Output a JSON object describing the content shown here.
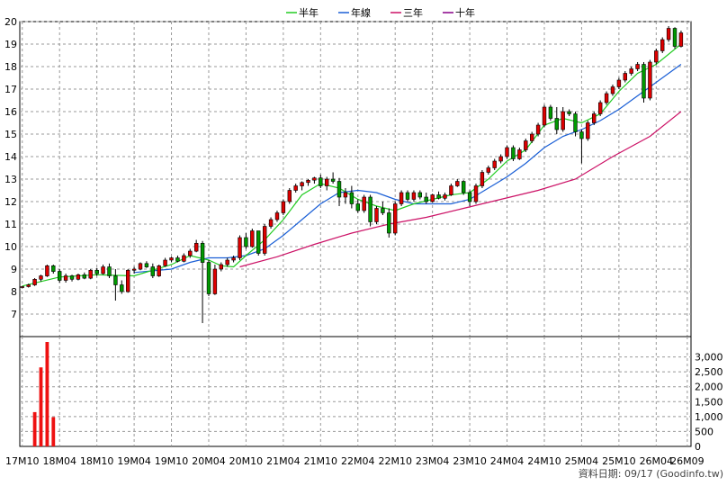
{
  "chart_data": [
    {
      "type": "candlestick",
      "title": "",
      "legend_position": "top-center",
      "grid": true,
      "legend": [
        {
          "label": "半年",
          "color": "#22cc22"
        },
        {
          "label": "年線",
          "color": "#1a5fd6"
        },
        {
          "label": "三年",
          "color": "#cc1166"
        },
        {
          "label": "十年",
          "color": "#880088"
        }
      ],
      "ylim": [
        6,
        20
      ],
      "y_ticks": [
        "7",
        "8",
        "9",
        "10",
        "11",
        "12",
        "13",
        "14",
        "15",
        "16",
        "17",
        "18",
        "19",
        "20"
      ],
      "x_ticks": [
        "17M10",
        "18M04",
        "18M10",
        "19M04",
        "19M10",
        "20M04",
        "20M10",
        "21M04",
        "21M10",
        "22M04",
        "22M10",
        "23M04",
        "23M10",
        "24M04",
        "24M10",
        "25M04",
        "25M10",
        "26M04",
        "26M09"
      ],
      "x_range": [
        "2017-10",
        "2026-09"
      ],
      "candles": [
        [
          "2017-10",
          8.2,
          8.25,
          8.15,
          8.22
        ],
        [
          "2017-11",
          8.22,
          8.35,
          8.18,
          8.3
        ],
        [
          "2017-12",
          8.3,
          8.6,
          8.25,
          8.55
        ],
        [
          "2018-01",
          8.55,
          8.75,
          8.45,
          8.7
        ],
        [
          "2018-02",
          8.7,
          9.2,
          8.65,
          9.15
        ],
        [
          "2018-03",
          9.15,
          9.2,
          8.8,
          8.9
        ],
        [
          "2018-04",
          8.9,
          9.0,
          8.4,
          8.5
        ],
        [
          "2018-05",
          8.5,
          8.8,
          8.4,
          8.7
        ],
        [
          "2018-06",
          8.7,
          8.75,
          8.45,
          8.55
        ],
        [
          "2018-07",
          8.55,
          8.8,
          8.5,
          8.75
        ],
        [
          "2018-08",
          8.75,
          8.85,
          8.55,
          8.6
        ],
        [
          "2018-09",
          8.6,
          9.0,
          8.55,
          8.95
        ],
        [
          "2018-10",
          8.95,
          9.05,
          8.7,
          8.8
        ],
        [
          "2018-11",
          8.8,
          9.2,
          8.75,
          9.1
        ],
        [
          "2018-12",
          9.1,
          9.25,
          8.6,
          8.7
        ],
        [
          "2019-01",
          8.7,
          9.0,
          7.6,
          8.3
        ],
        [
          "2019-02",
          8.3,
          8.5,
          7.9,
          8.0
        ],
        [
          "2019-03",
          8.0,
          9.0,
          7.95,
          8.95
        ],
        [
          "2019-04",
          8.95,
          9.1,
          8.8,
          9.0
        ],
        [
          "2019-05",
          9.0,
          9.3,
          8.95,
          9.25
        ],
        [
          "2019-06",
          9.25,
          9.35,
          9.05,
          9.1
        ],
        [
          "2019-07",
          9.1,
          9.25,
          8.6,
          8.7
        ],
        [
          "2019-08",
          8.7,
          9.2,
          8.65,
          9.15
        ],
        [
          "2019-09",
          9.15,
          9.5,
          9.1,
          9.4
        ],
        [
          "2019-10",
          9.4,
          9.55,
          9.3,
          9.5
        ],
        [
          "2019-11",
          9.5,
          9.6,
          9.3,
          9.35
        ],
        [
          "2019-12",
          9.35,
          9.7,
          9.3,
          9.6
        ],
        [
          "2020-01",
          9.6,
          9.9,
          9.5,
          9.8
        ],
        [
          "2020-02",
          9.8,
          10.3,
          9.75,
          10.15
        ],
        [
          "2020-03",
          10.15,
          10.25,
          6.6,
          9.3
        ],
        [
          "2020-04",
          9.3,
          9.4,
          7.8,
          7.9
        ],
        [
          "2020-05",
          7.9,
          9.2,
          7.85,
          9.0
        ],
        [
          "2020-06",
          9.0,
          9.3,
          8.9,
          9.2
        ],
        [
          "2020-07",
          9.2,
          9.5,
          9.1,
          9.4
        ],
        [
          "2020-08",
          9.4,
          9.6,
          9.3,
          9.5
        ],
        [
          "2020-09",
          9.5,
          10.5,
          9.4,
          10.4
        ],
        [
          "2020-10",
          10.4,
          10.6,
          9.9,
          10.0
        ],
        [
          "2020-11",
          10.0,
          10.8,
          9.95,
          10.7
        ],
        [
          "2020-12",
          10.7,
          10.6,
          9.6,
          9.7
        ],
        [
          "2021-01",
          9.7,
          11.0,
          9.6,
          10.9
        ],
        [
          "2021-02",
          10.9,
          11.3,
          10.8,
          11.2
        ],
        [
          "2021-03",
          11.2,
          11.6,
          11.1,
          11.5
        ],
        [
          "2021-04",
          11.5,
          12.1,
          11.4,
          12.0
        ],
        [
          "2021-05",
          12.0,
          12.6,
          11.9,
          12.5
        ],
        [
          "2021-06",
          12.5,
          12.8,
          12.4,
          12.7
        ],
        [
          "2021-07",
          12.7,
          12.9,
          12.5,
          12.85
        ],
        [
          "2021-08",
          12.85,
          13.0,
          12.7,
          12.95
        ],
        [
          "2021-09",
          12.95,
          13.1,
          12.8,
          13.05
        ],
        [
          "2021-10",
          13.05,
          13.2,
          12.6,
          12.7
        ],
        [
          "2021-11",
          12.7,
          13.1,
          12.5,
          13.0
        ],
        [
          "2021-12",
          13.0,
          13.3,
          12.8,
          12.9
        ],
        [
          "2022-01",
          12.9,
          13.05,
          11.8,
          12.2
        ],
        [
          "2022-02",
          12.2,
          12.6,
          11.9,
          12.4
        ],
        [
          "2022-03",
          12.4,
          12.7,
          11.7,
          11.9
        ],
        [
          "2022-04",
          11.9,
          12.1,
          11.5,
          11.6
        ],
        [
          "2022-05",
          11.6,
          12.3,
          11.5,
          12.2
        ],
        [
          "2022-06",
          12.2,
          12.3,
          10.9,
          11.1
        ],
        [
          "2022-07",
          11.1,
          11.8,
          11.0,
          11.7
        ],
        [
          "2022-08",
          11.7,
          12.0,
          11.4,
          11.5
        ],
        [
          "2022-09",
          11.5,
          11.7,
          10.4,
          10.6
        ],
        [
          "2022-10",
          10.6,
          12.0,
          10.5,
          11.9
        ],
        [
          "2022-11",
          11.9,
          12.5,
          11.8,
          12.4
        ],
        [
          "2022-12",
          12.4,
          12.5,
          12.0,
          12.1
        ],
        [
          "2023-01",
          12.1,
          12.5,
          12.0,
          12.4
        ],
        [
          "2023-02",
          12.4,
          12.5,
          12.1,
          12.2
        ],
        [
          "2023-03",
          12.2,
          12.4,
          11.9,
          12.0
        ],
        [
          "2023-04",
          12.0,
          12.35,
          11.95,
          12.3
        ],
        [
          "2023-05",
          12.3,
          12.45,
          12.1,
          12.15
        ],
        [
          "2023-06",
          12.15,
          12.4,
          12.05,
          12.3
        ],
        [
          "2023-07",
          12.3,
          12.8,
          12.25,
          12.7
        ],
        [
          "2023-08",
          12.7,
          13.0,
          12.65,
          12.9
        ],
        [
          "2023-09",
          12.9,
          12.95,
          12.3,
          12.4
        ],
        [
          "2023-10",
          12.4,
          12.5,
          11.8,
          12.0
        ],
        [
          "2023-11",
          12.0,
          12.8,
          11.9,
          12.7
        ],
        [
          "2023-12",
          12.7,
          13.4,
          12.6,
          13.3
        ],
        [
          "2024-01",
          13.3,
          13.6,
          13.2,
          13.5
        ],
        [
          "2024-02",
          13.5,
          13.9,
          13.4,
          13.8
        ],
        [
          "2024-03",
          13.8,
          14.1,
          13.7,
          14.0
        ],
        [
          "2024-04",
          14.0,
          14.5,
          13.9,
          14.4
        ],
        [
          "2024-05",
          14.4,
          14.5,
          13.8,
          13.9
        ],
        [
          "2024-06",
          13.9,
          14.4,
          13.85,
          14.3
        ],
        [
          "2024-07",
          14.3,
          14.8,
          14.2,
          14.7
        ],
        [
          "2024-08",
          14.7,
          15.1,
          14.6,
          15.0
        ],
        [
          "2024-09",
          15.0,
          15.5,
          14.9,
          15.4
        ],
        [
          "2024-10",
          15.4,
          16.3,
          15.3,
          16.2
        ],
        [
          "2024-11",
          16.2,
          16.3,
          15.6,
          15.7
        ],
        [
          "2024-12",
          15.7,
          16.2,
          15.0,
          15.2
        ],
        [
          "2025-01",
          15.2,
          16.2,
          15.1,
          16.0
        ],
        [
          "2025-02",
          16.0,
          16.1,
          15.8,
          15.9
        ],
        [
          "2025-03",
          15.9,
          16.0,
          14.9,
          15.1
        ],
        [
          "2025-04",
          15.1,
          15.2,
          13.7,
          14.8
        ],
        [
          "2025-05",
          14.8,
          15.6,
          14.7,
          15.5
        ],
        [
          "2025-06",
          15.5,
          16.0,
          15.4,
          15.9
        ],
        [
          "2025-07",
          15.9,
          16.5,
          15.8,
          16.4
        ],
        [
          "2025-08",
          16.4,
          16.9,
          16.3,
          16.8
        ],
        [
          "2025-09",
          16.8,
          17.2,
          16.7,
          17.1
        ],
        [
          "2025-10",
          17.1,
          17.5,
          17.0,
          17.4
        ],
        [
          "2025-11",
          17.4,
          17.8,
          17.3,
          17.7
        ],
        [
          "2025-12",
          17.7,
          18.0,
          17.6,
          17.9
        ],
        [
          "2026-01",
          17.9,
          18.2,
          17.8,
          18.1
        ],
        [
          "2026-02",
          18.1,
          18.2,
          16.4,
          16.6
        ],
        [
          "2026-03",
          16.6,
          18.3,
          16.5,
          18.2
        ],
        [
          "2026-04",
          18.2,
          18.8,
          18.1,
          18.7
        ],
        [
          "2026-05",
          18.7,
          19.3,
          18.6,
          19.2
        ],
        [
          "2026-06",
          19.2,
          19.8,
          19.1,
          19.7
        ],
        [
          "2026-07",
          19.7,
          19.75,
          18.8,
          18.9
        ],
        [
          "2026-08",
          18.9,
          19.6,
          18.85,
          19.5
        ]
      ],
      "ma_halfyear": [
        [
          "2017-10",
          8.25
        ],
        [
          "2018-04",
          8.65
        ],
        [
          "2018-10",
          8.75
        ],
        [
          "2019-04",
          8.7
        ],
        [
          "2019-10",
          9.2
        ],
        [
          "2020-01",
          9.6
        ],
        [
          "2020-04",
          9.4
        ],
        [
          "2020-06",
          9.15
        ],
        [
          "2020-08",
          9.1
        ],
        [
          "2020-10",
          9.6
        ],
        [
          "2021-01",
          10.3
        ],
        [
          "2021-04",
          11.2
        ],
        [
          "2021-07",
          12.3
        ],
        [
          "2021-10",
          12.8
        ],
        [
          "2022-01",
          12.6
        ],
        [
          "2022-04",
          12.1
        ],
        [
          "2022-07",
          11.8
        ],
        [
          "2022-10",
          11.6
        ],
        [
          "2023-01",
          11.9
        ],
        [
          "2023-04",
          12.1
        ],
        [
          "2023-07",
          12.3
        ],
        [
          "2023-10",
          12.4
        ],
        [
          "2024-01",
          13.0
        ],
        [
          "2024-04",
          13.8
        ],
        [
          "2024-07",
          14.3
        ],
        [
          "2024-10",
          15.4
        ],
        [
          "2025-01",
          15.7
        ],
        [
          "2025-04",
          15.5
        ],
        [
          "2025-07",
          15.9
        ],
        [
          "2025-10",
          16.9
        ],
        [
          "2026-01",
          17.7
        ],
        [
          "2026-04",
          18.1
        ],
        [
          "2026-08",
          19.0
        ]
      ],
      "ma_year": [
        [
          "2019-04",
          8.85
        ],
        [
          "2019-10",
          9.0
        ],
        [
          "2020-01",
          9.3
        ],
        [
          "2020-04",
          9.5
        ],
        [
          "2020-07",
          9.5
        ],
        [
          "2020-10",
          9.6
        ],
        [
          "2021-01",
          9.9
        ],
        [
          "2021-04",
          10.5
        ],
        [
          "2021-07",
          11.2
        ],
        [
          "2021-10",
          11.9
        ],
        [
          "2022-01",
          12.4
        ],
        [
          "2022-04",
          12.5
        ],
        [
          "2022-07",
          12.4
        ],
        [
          "2022-10",
          12.1
        ],
        [
          "2023-01",
          11.9
        ],
        [
          "2023-04",
          11.9
        ],
        [
          "2023-07",
          11.9
        ],
        [
          "2023-10",
          12.1
        ],
        [
          "2024-01",
          12.6
        ],
        [
          "2024-04",
          13.1
        ],
        [
          "2024-07",
          13.7
        ],
        [
          "2024-10",
          14.4
        ],
        [
          "2025-01",
          14.9
        ],
        [
          "2025-04",
          15.2
        ],
        [
          "2025-07",
          15.6
        ],
        [
          "2025-10",
          16.1
        ],
        [
          "2026-01",
          16.7
        ],
        [
          "2026-04",
          17.3
        ],
        [
          "2026-08",
          18.1
        ]
      ],
      "ma_threeyear": [
        [
          "2020-09",
          9.1
        ],
        [
          "2021-03",
          9.55
        ],
        [
          "2021-09",
          10.1
        ],
        [
          "2022-03",
          10.6
        ],
        [
          "2022-09",
          11.0
        ],
        [
          "2023-03",
          11.3
        ],
        [
          "2023-09",
          11.7
        ],
        [
          "2024-03",
          12.1
        ],
        [
          "2024-09",
          12.5
        ],
        [
          "2025-03",
          13.0
        ],
        [
          "2025-09",
          14.0
        ],
        [
          "2026-03",
          14.9
        ],
        [
          "2026-08",
          16.0
        ]
      ]
    },
    {
      "type": "bar",
      "title": "",
      "ylim": [
        0,
        3500
      ],
      "y_ticks": [
        "0",
        "500",
        "1,000",
        "1,500",
        "2,000",
        "2,500",
        "3,000"
      ],
      "bars": [
        [
          "2017-12",
          1150
        ],
        [
          "2018-01",
          2650
        ],
        [
          "2018-02",
          3500
        ],
        [
          "2018-03",
          980
        ]
      ],
      "color": "#ee1111"
    }
  ],
  "footer_text": "資料日期: 09/17 (Goodinfo.tw)"
}
